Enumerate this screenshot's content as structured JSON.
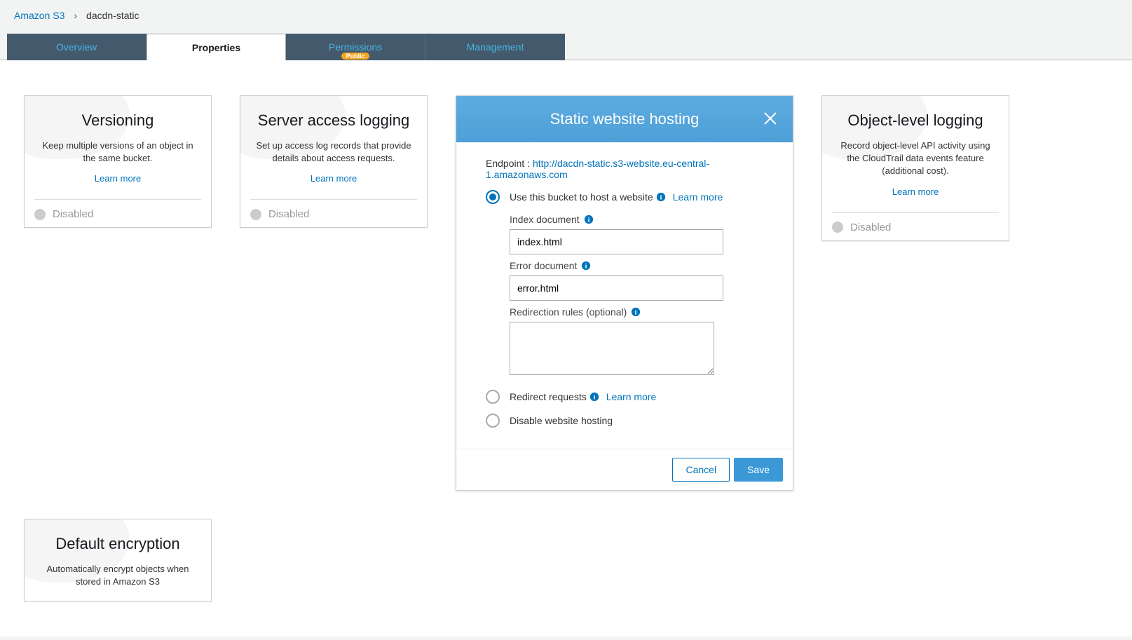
{
  "breadcrumb": {
    "root": "Amazon S3",
    "current": "dacdn-static"
  },
  "tabs": {
    "overview": "Overview",
    "properties": "Properties",
    "permissions": "Permissions",
    "permissions_badge": "Public",
    "management": "Management"
  },
  "cards": {
    "versioning": {
      "title": "Versioning",
      "desc": "Keep multiple versions of an object in the same bucket.",
      "learn": "Learn more",
      "status": "Disabled"
    },
    "logging": {
      "title": "Server access logging",
      "desc": "Set up access log records that provide details about access requests.",
      "learn": "Learn more",
      "status": "Disabled"
    },
    "objectlog": {
      "title": "Object-level logging",
      "desc": "Record object-level API activity using the CloudTrail data events feature (additional cost).",
      "learn": "Learn more",
      "status": "Disabled"
    },
    "encryption": {
      "title": "Default encryption",
      "desc": "Automatically encrypt objects when stored in Amazon S3"
    }
  },
  "hosting": {
    "title": "Static website hosting",
    "endpoint_label": "Endpoint : ",
    "endpoint_url": "http://dacdn-static.s3-website.eu-central-1.amazonaws.com",
    "opt_host": "Use this bucket to host a website",
    "learn": "Learn more",
    "index_label": "Index document",
    "index_value": "index.html",
    "error_label": "Error document",
    "error_value": "error.html",
    "redir_label": "Redirection rules (optional)",
    "redir_value": "",
    "opt_redirect": "Redirect requests",
    "opt_disable": "Disable website hosting",
    "cancel": "Cancel",
    "save": "Save"
  }
}
